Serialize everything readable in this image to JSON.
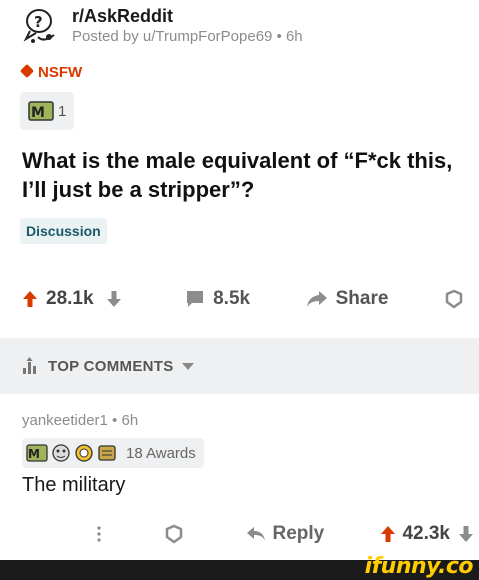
{
  "post": {
    "subreddit": "r/AskReddit",
    "posted_by": "Posted by u/TrumpForPope69 • 6h",
    "nsfw_label": "NSFW",
    "award_count": "1",
    "title": "What is the male equivalent of “F*ck this, I’ll just be a stripper”?",
    "flair": "Discussion"
  },
  "actions": {
    "upvotes": "28.1k",
    "comments": "8.5k",
    "share": "Share"
  },
  "comments_bar": {
    "label": "TOP COMMENTS"
  },
  "comment": {
    "author_time": "yankeetider1 • 6h",
    "awards": "18 Awards",
    "text": "The military",
    "reply": "Reply",
    "score": "42.3k"
  },
  "watermark": "ifunny.co",
  "colors": {
    "upvote": "#d93a00",
    "nsfw": "#d93a00",
    "flair_text": "#1c5a6a",
    "watermark": "#ffcc00"
  }
}
